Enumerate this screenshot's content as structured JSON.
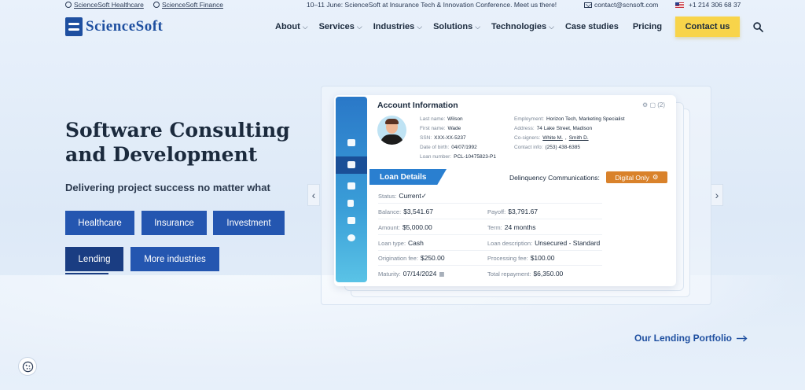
{
  "topbar": {
    "link1": "ScienceSoft Healthcare",
    "link2": "ScienceSoft Finance",
    "announcement": "10–11 June: ScienceSoft at Insurance Tech & Innovation Conference. Meet us there!",
    "email": "contact@scnsoft.com",
    "phone": "+1 214 306 68 37"
  },
  "header": {
    "logo_text": "ScienceSoft",
    "nav": [
      "About",
      "Services",
      "Industries",
      "Solutions",
      "Technologies",
      "Case studies",
      "Pricing"
    ],
    "contact_label": "Contact us"
  },
  "hero": {
    "title": "Software Consulting and Development",
    "subtitle": "Delivering project success no matter what",
    "industries": [
      "Healthcare",
      "Insurance",
      "Investment",
      "Lending",
      "More industries"
    ],
    "active_industry": "Lending"
  },
  "card": {
    "title": "Account Information",
    "tools": "⚙ ▢ (2)",
    "last_name_k": "Last name:",
    "last_name": "Wilson",
    "first_name_k": "First name:",
    "first_name": "Wade",
    "ssn_k": "SSN:",
    "ssn": "XXX-XX-5237",
    "dob_k": "Date of birth:",
    "dob": "04/07/1992",
    "loan_no_k": "Loan number:",
    "loan_no": "PCL-10475823-P1",
    "employment_k": "Employment:",
    "employment": "Horizon Tech, Marketing Specialist",
    "address_k": "Address:",
    "address": "74 Lake Street, Madison",
    "cosigners_k": "Co-signers:",
    "cosigner1": "White M.",
    "cosigner2": "Smith D.",
    "contact_k": "Contact info:",
    "contact": "(253) 438-6385",
    "loan_tab": "Loan Details",
    "delinquency_label": "Delinquency Communications:",
    "delinquency_value": "Digital Only",
    "status_k": "Status:",
    "status": "Current✓",
    "balance_k": "Balance:",
    "balance": "$3,541.67",
    "payoff_k": "Payoff:",
    "payoff": "$3,791.67",
    "amount_k": "Amount:",
    "amount": "$5,000.00",
    "term_k": "Term:",
    "term": "24 months",
    "loan_type_k": "Loan type:",
    "loan_type": "Cash",
    "loan_desc_k": "Loan description:",
    "loan_desc": "Unsecured - Standard",
    "orig_fee_k": "Origination fee:",
    "orig_fee": "$250.00",
    "proc_fee_k": "Processing fee:",
    "proc_fee": "$100.00",
    "maturity_k": "Maturity:",
    "maturity": "07/14/2024",
    "total_k": "Total repayment:",
    "total": "$6,350.00"
  },
  "portfolio_link": "Our Lending Portfolio",
  "colors": {
    "brand": "#1e4fa0",
    "cta": "#f8d44a",
    "accent": "#d9822b"
  }
}
